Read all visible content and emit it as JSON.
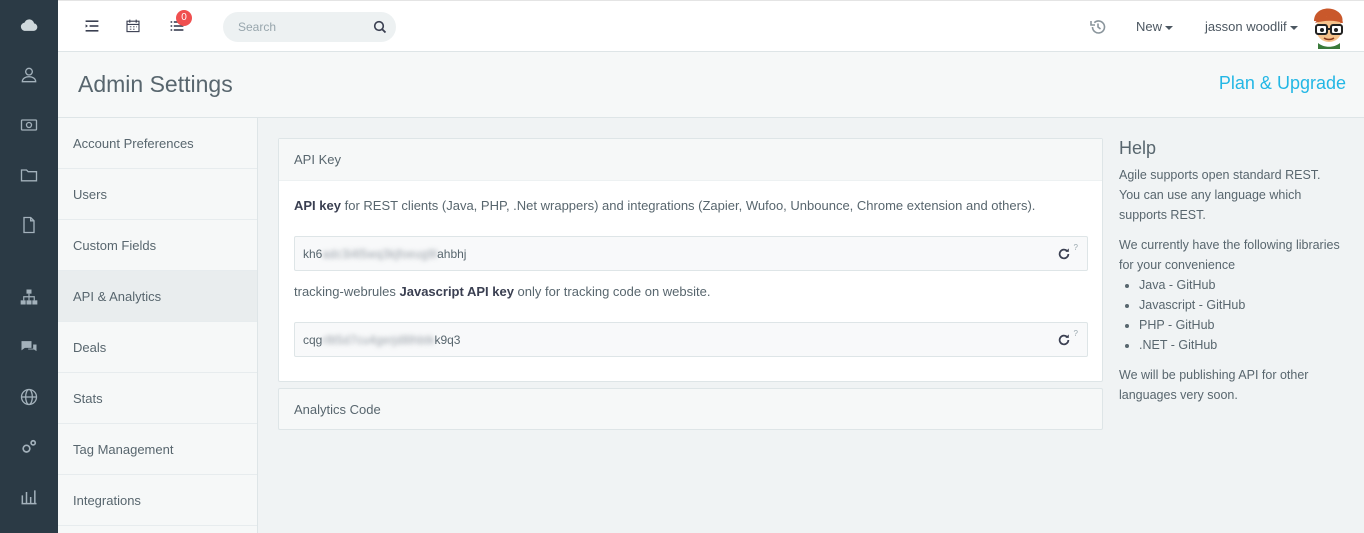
{
  "rail": {
    "items": [
      "cloud-icon",
      "user-icon",
      "money-icon",
      "folder-icon",
      "document-icon",
      "sitemap-icon",
      "chat-icon",
      "globe-icon",
      "cogs-icon",
      "bar-chart-icon"
    ]
  },
  "topbar": {
    "notification_count": "0",
    "search_placeholder": "Search",
    "new_label": "New",
    "user_name": "jasson woodlif"
  },
  "title": {
    "page_title": "Admin Settings",
    "plan_link": "Plan & Upgrade"
  },
  "sidebar": {
    "items": [
      {
        "label": "Account Preferences"
      },
      {
        "label": "Users"
      },
      {
        "label": "Custom Fields"
      },
      {
        "label": "API & Analytics"
      },
      {
        "label": "Deals"
      },
      {
        "label": "Stats"
      },
      {
        "label": "Tag Management"
      },
      {
        "label": "Integrations"
      }
    ],
    "active_index": 3
  },
  "api_panel": {
    "heading": "API Key",
    "api_key_bold": "API key",
    "api_key_desc": " for REST clients (Java, PHP, .Net wrappers) and integrations (Zapier, Wufoo, Unbounce, Chrome extension and others).",
    "api_key_prefix": "kh6",
    "api_key_hidden": "adc3i4l5wq3kjfoeug9l",
    "api_key_suffix": "ahbhj",
    "tracking_prefix": "tracking-webrules ",
    "tracking_bold": "Javascript API key",
    "tracking_suffix": " only for tracking code on website.",
    "js_key_prefix": "cqg",
    "js_key_hidden": "r8t5d7cu4gerjd8lhbtk",
    "js_key_suffix": "k9q3",
    "help_mark": "?"
  },
  "analytics_panel": {
    "heading": "Analytics Code"
  },
  "help": {
    "heading": "Help",
    "para1": "Agile supports open standard REST. You can use any language which supports REST.",
    "para2": "We currently have the following libraries for your convenience",
    "libraries": [
      "Java - GitHub",
      "Javascript - GitHub",
      "PHP - GitHub",
      ".NET - GitHub"
    ],
    "para3": "We will be publishing API for other languages very soon."
  },
  "colors": {
    "rail_bg": "#2b3a45",
    "accent_link": "#23b7e5",
    "badge": "#f05050"
  }
}
